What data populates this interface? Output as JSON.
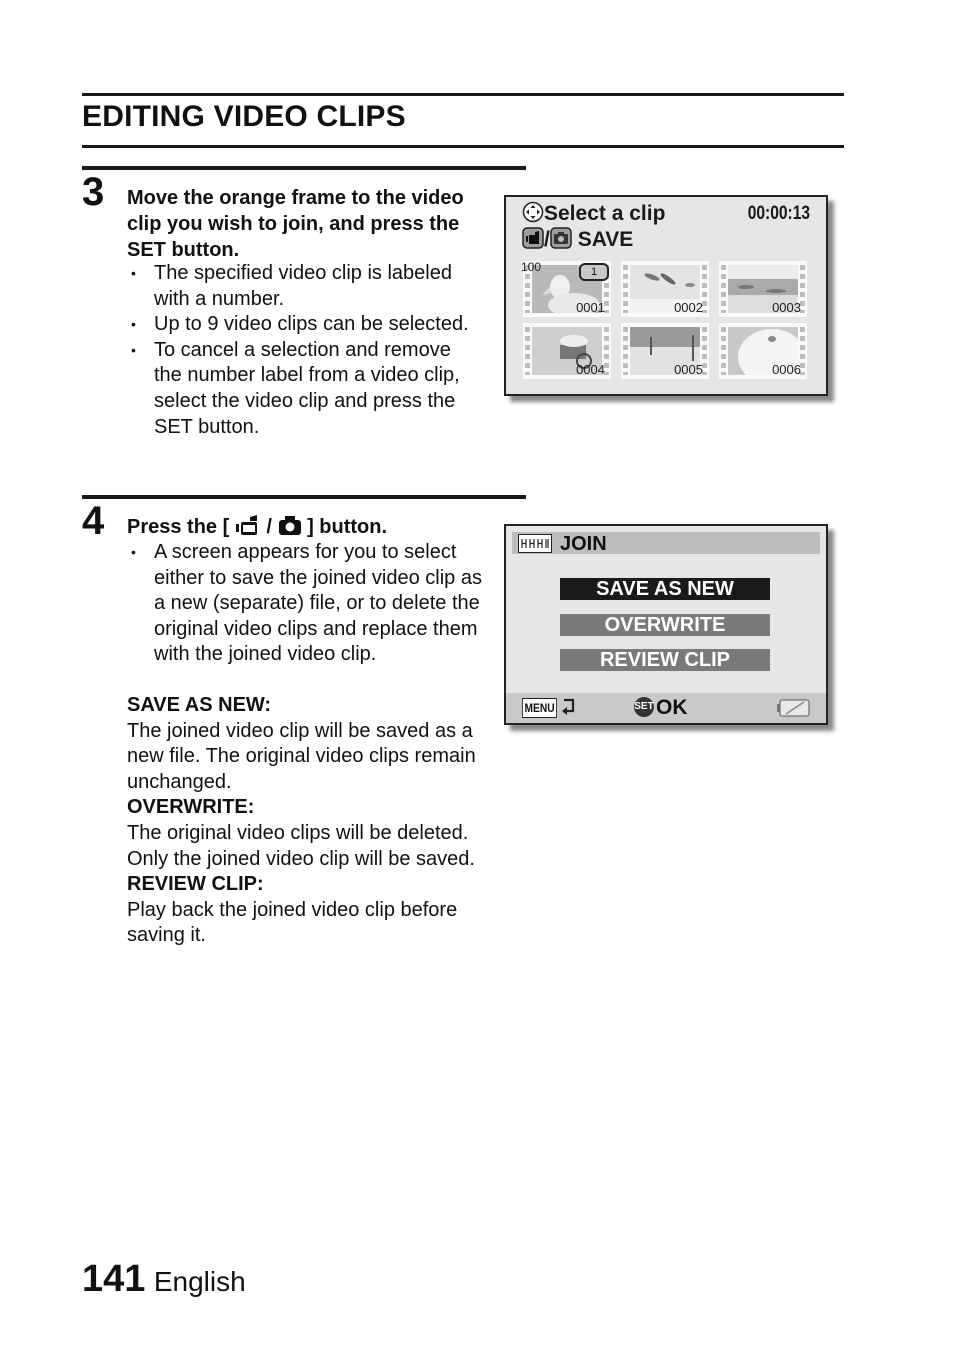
{
  "page": {
    "section_title": "EDITING VIDEO CLIPS",
    "page_number": "141",
    "language": "English"
  },
  "step3": {
    "number": "3",
    "heading": "Move the orange frame to the video clip you wish to join, and press the SET button.",
    "bullets": [
      "The specified video clip is labeled with a number.",
      "Up to 9 video clips can be selected.",
      "To cancel a selection and remove the number label from a video clip, select the video clip and press the SET button."
    ]
  },
  "step4": {
    "number": "4",
    "heading_prefix": "Press the [",
    "heading_sep": "/",
    "heading_suffix": "] button.",
    "bullets": [
      "A screen appears for you to select either to save the joined video clip as a new (separate) file, or to delete the original video clips and replace them with the joined video clip."
    ],
    "options": [
      {
        "term": "SAVE AS NEW:",
        "desc": "The joined video clip will be saved as a new file. The original video clips remain unchanged."
      },
      {
        "term": "OVERWRITE:",
        "desc": "The original video clips will be deleted. Only the joined video clip will be saved."
      },
      {
        "term": "REVIEW CLIP:",
        "desc": "Play back the joined video clip before saving it."
      }
    ]
  },
  "screen1": {
    "line1": "Select a clip",
    "line2_sep": "/",
    "line2": "SAVE",
    "timecode": "00:00:13",
    "folder": "100",
    "selected_badge": "1",
    "thumbnails": [
      {
        "id": "0001",
        "subject": "duck",
        "selected": true
      },
      {
        "id": "0002",
        "subject": "dolphins",
        "selected": false
      },
      {
        "id": "0003",
        "subject": "garden",
        "selected": false
      },
      {
        "id": "0004",
        "subject": "flower cart",
        "selected": false
      },
      {
        "id": "0005",
        "subject": "park trees",
        "selected": false
      },
      {
        "id": "0006",
        "subject": "rabbit",
        "selected": false
      }
    ]
  },
  "screen2": {
    "title": "JOIN",
    "options": [
      "SAVE AS NEW",
      "OVERWRITE",
      "REVIEW CLIP"
    ],
    "selected_index": 0,
    "menu_label": "MENU",
    "set_label": "SET",
    "ok_label": "OK",
    "colors": {
      "selected": "#1a1a1a",
      "unselected": "#7a7a7a"
    }
  }
}
